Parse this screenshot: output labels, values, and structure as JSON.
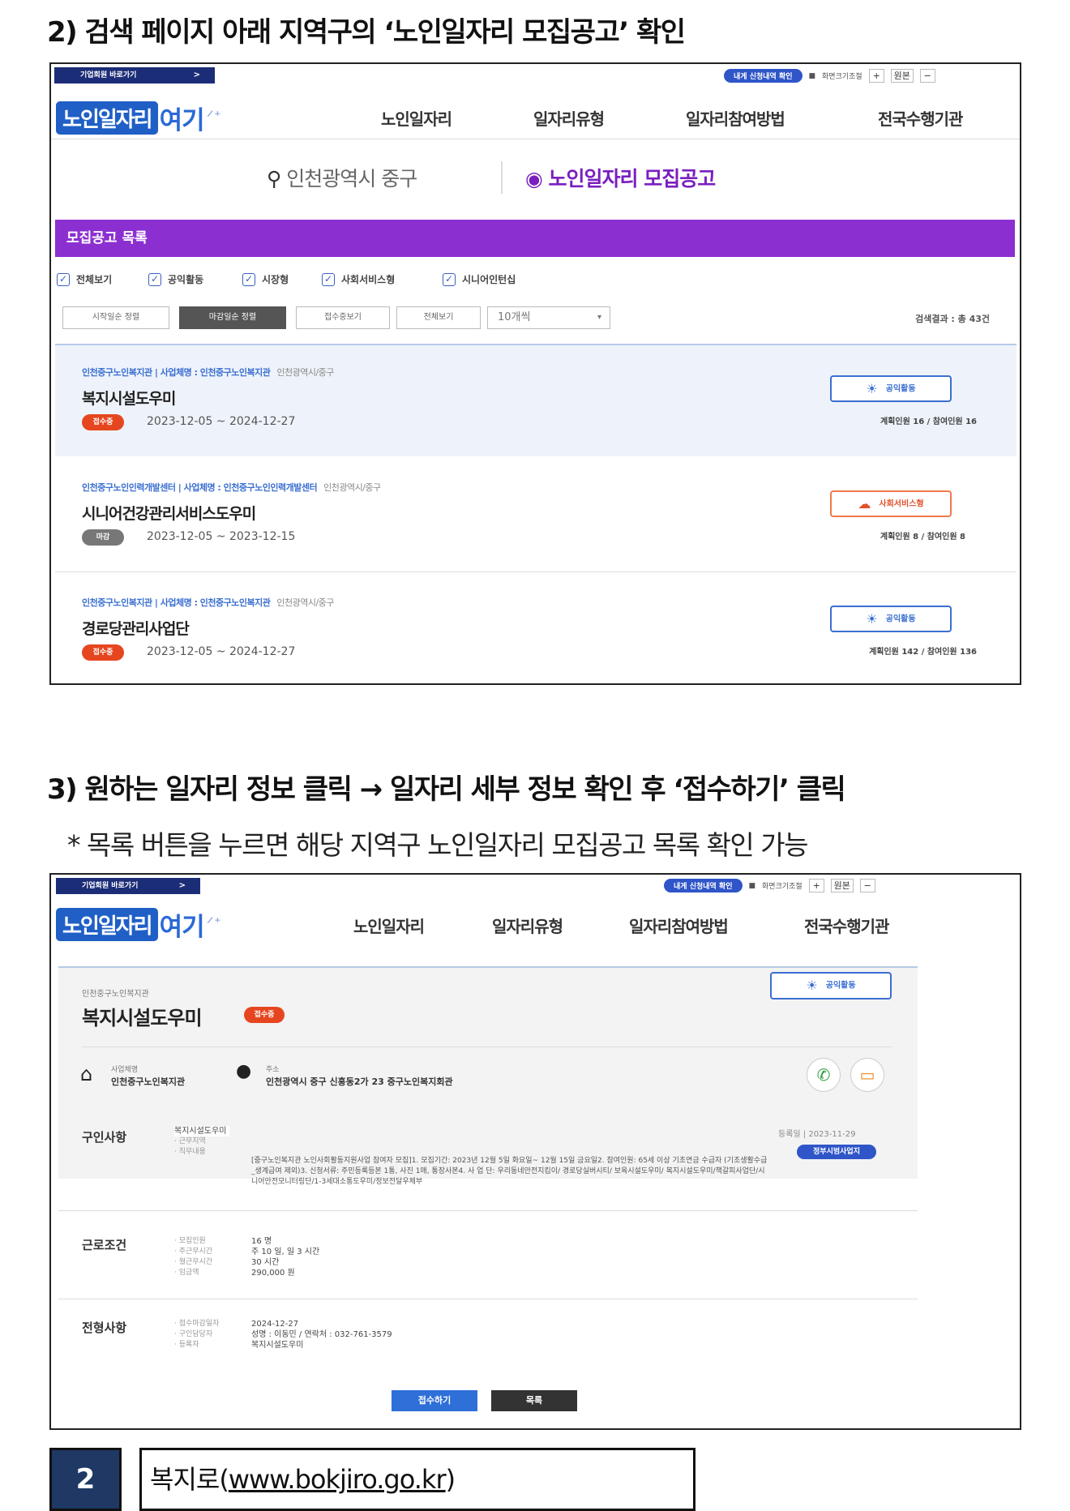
{
  "section2": {
    "heading": "2) 검색 페이지 아래 지역구의 ‘노인일자리 모집공고’ 확인"
  },
  "site": {
    "topbar_button": "기업회원 바로가기",
    "topbar_chevron": ">",
    "util_pill": "내게 신청내역 확인",
    "util_links": "화면크기조절",
    "util_plus": "+",
    "util_reset": "원본",
    "util_minus": "−",
    "logo_main": "노인일자리",
    "logo_sub": "여기",
    "nav": [
      "노인일자리",
      "일자리유형",
      "일자리참여방법",
      "전국수행기관"
    ]
  },
  "listing": {
    "region": "인천광역시 중구",
    "recruit_title": "노인일자리 모집공고",
    "bar_title": "모집공고 목록",
    "checkboxes": [
      "전체보기",
      "공익활동",
      "시장형",
      "사회서비스형",
      "시니어인턴십"
    ],
    "filter_buttons": [
      "시작일순 정렬",
      "마감일순 정렬",
      "접수중보기",
      "전체보기"
    ],
    "page_size": "10개씩",
    "result_count": "검색결과 : 총 43건",
    "items": [
      {
        "meta": "인천중구노인복지관  |  사업체명 : 인천중구노인복지관",
        "meta_region": "인천광역시/중구",
        "title": "복지시설도우미",
        "status": "접수중",
        "dates": "2023-12-05 ~ 2024-12-27",
        "tag": "공익활동",
        "persons": "계획인원 16 / 참여인원 16"
      },
      {
        "meta": "인천중구노인인력개발센터  |  사업체명 : 인천중구노인인력개발센터",
        "meta_region": "인천광역시/중구",
        "title": "시니어건강관리서비스도우미",
        "status": "마감",
        "dates": "2023-12-05 ~ 2023-12-15",
        "tag": "사회서비스형",
        "persons": "계획인원 8 / 참여인원 8"
      },
      {
        "meta": "인천중구노인복지관  |  사업체명 : 인천중구노인복지관",
        "meta_region": "인천광역시/중구",
        "title": "경로당관리사업단",
        "status": "접수중",
        "dates": "2023-12-05 ~ 2024-12-27",
        "tag": "공익활동",
        "persons": "계획인원 142 / 참여인원 136"
      }
    ]
  },
  "section3": {
    "heading": "3) 원하는 일자리 정보 클릭 → 일자리 세부 정보 확인 후 ‘접수하기’ 클릭",
    "note": "* 목록 버튼을 누르면 해당 지역구 노인일자리 모집공고 목록 확인 가능"
  },
  "detail": {
    "org": "인천중구노인복지관",
    "title": "복지시설도우미",
    "status": "접수중",
    "tag": "공익활동",
    "business_label": "사업체명",
    "business_value": "인천중구노인복지관",
    "address_label": "주소",
    "address_value": "인천광역시 중구 신흥동2가 23 중구노인복지회관",
    "registered": "등록일 | 2023-11-29",
    "job_pill": "정부시범사업지",
    "sections": {
      "hiring": {
        "title": "구인사항",
        "labels": "· 직종\n· 근무지역\n· 직무내용",
        "value_first": "복지시설도우미",
        "description": "[중구노인복지관 노인사회활동지원사업 참여자 모집]1. 모집기간: 2023년 12월 5일 화요일~ 12월 15일 금요일2. 참여인원: 65세 이상 기초연금 수급자 (기초생활수급_생계급여 제외)3. 신청서류: 주민등록등본 1통, 사진 1매, 통장사본4. 사 업 단: 우리동네안전지킴이/ 경로당실버시티/ 보육시설도우미/ 복지시설도우미/책갈피사업단/시니어안전모니터링단/1-3세대소통도우미/정보전달우체부"
      },
      "conditions": {
        "title": "근로조건",
        "labels": "· 모집인원\n· 주근무시간\n· 월근무시간\n· 임금액",
        "values": [
          "16 명",
          "주 10 일, 일 3 시간",
          "30 시간",
          "290,000 원"
        ]
      },
      "screening": {
        "title": "전형사항",
        "labels": "· 접수마감일자\n· 구인담당자\n· 등록자",
        "values": [
          "2024-12-27",
          "성명 : 이동민 / 연락처 : 032-761-3579",
          "복지시설도우미"
        ]
      }
    },
    "apply_button": "접수하기",
    "list_button": "목록"
  },
  "footer": {
    "page_number": "2",
    "site_name": "복지로(",
    "site_url": "www.bokjiro.go.kr",
    "site_close": ")"
  },
  "colors": {
    "purple_bar": "#8c2fd1",
    "brand_blue": "#1f5fc6",
    "status_open": "#e6461f",
    "status_closed": "#777777",
    "page_badge": "#1f3864"
  }
}
